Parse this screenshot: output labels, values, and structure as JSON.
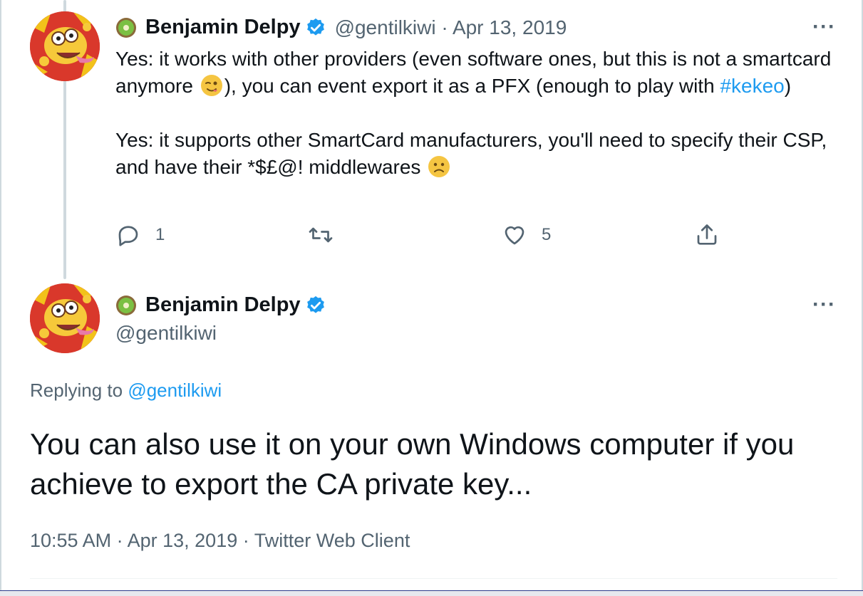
{
  "colors": {
    "link": "#1d9bf0",
    "muted_text": "#536471",
    "primary_text": "#0f1419",
    "thread_line": "#cfd9de"
  },
  "icons": {
    "kiwi": "kiwi-emoji-icon",
    "verified": "verified-badge-icon",
    "more": "more-horizontal-icon",
    "reply": "reply-icon",
    "retweet": "retweet-icon",
    "like": "like-icon",
    "share": "share-icon",
    "winking_emoji": "winking-face-emoji-icon",
    "frowning_emoji": "frowning-face-emoji-icon"
  },
  "reply_tweet": {
    "display_name": "Benjamin Delpy",
    "handle": "@gentilkiwi",
    "separator": "·",
    "date": "Apr 13, 2019",
    "text": {
      "line1_before_emoji": "Yes: it works with other providers (even software ones, but this is not a smartcard anymore",
      "line1_after_emoji": "), you can event export it as a PFX (enough to play with",
      "hashtag": "#kekeo",
      "line1_end": ")",
      "line2_before_emoji": "Yes: it supports other SmartCard manufacturers, you'll need to specify their CSP, and have their *$£@! middlewares"
    },
    "counts": {
      "replies": "1",
      "retweets": "",
      "likes": "5"
    },
    "more_label": "···"
  },
  "main_tweet": {
    "display_name": "Benjamin Delpy",
    "handle": "@gentilkiwi",
    "more_label": "···",
    "replying_prefix": "Replying to",
    "replying_to": "@gentilkiwi",
    "text": "You can also use it on your own Windows computer if you achieve to export the CA private key...",
    "time": "10:55 AM",
    "date": "Apr 13, 2019",
    "source": "Twitter Web Client",
    "separator": "·"
  }
}
